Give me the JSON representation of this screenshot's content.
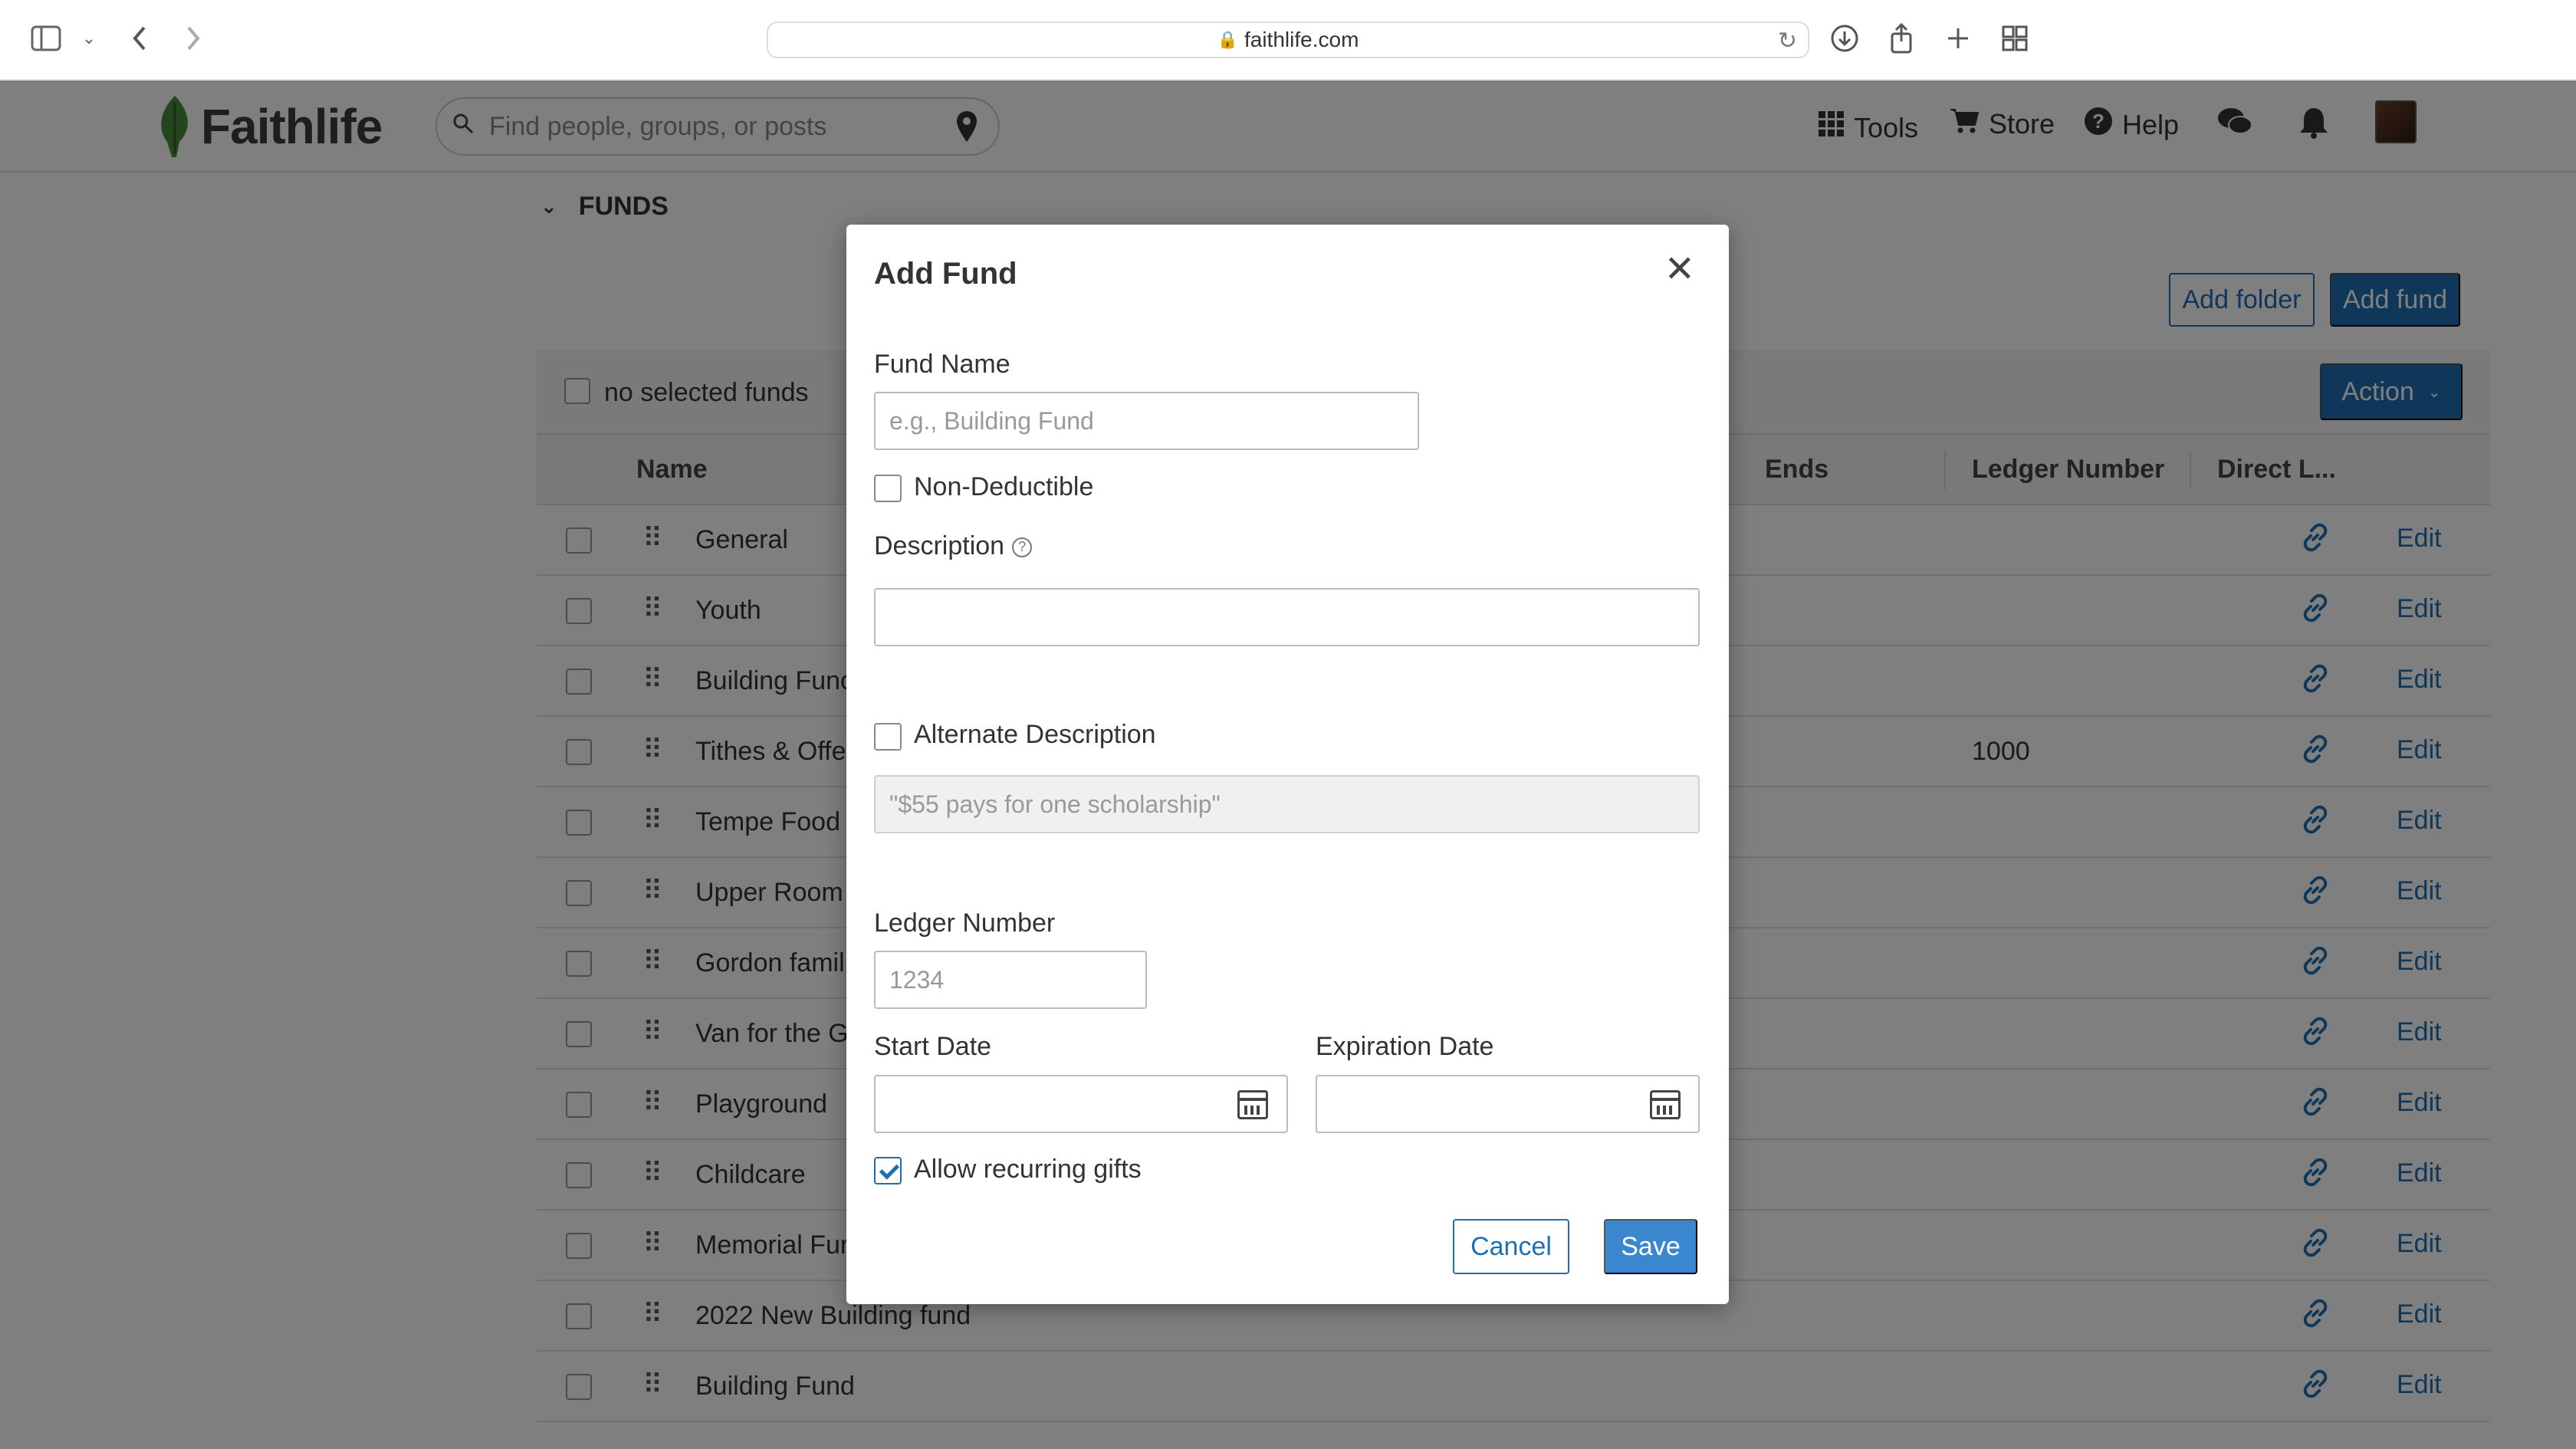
{
  "browser": {
    "url": "faithlife.com"
  },
  "header": {
    "logo_text": "Faithlife",
    "search_placeholder": "Find people, groups, or posts",
    "nav": [
      {
        "label": "Tools",
        "icon": "grid-icon"
      },
      {
        "label": "Store",
        "icon": "cart-icon"
      },
      {
        "label": "Help",
        "icon": "help-circle-icon"
      }
    ]
  },
  "page": {
    "section_title": "FUNDS",
    "add_folder_label": "Add folder",
    "add_fund_label": "Add fund",
    "selection_label": "no selected funds",
    "action_label": "Action",
    "columns": {
      "name": "Name",
      "ends": "Ends",
      "ledger": "Ledger Number",
      "direct_link": "Direct L..."
    },
    "rows": [
      {
        "name": "General",
        "ledger": "",
        "edit": "Edit"
      },
      {
        "name": "Youth",
        "ledger": "",
        "edit": "Edit"
      },
      {
        "name": "Building Func",
        "ledger": "",
        "edit": "Edit"
      },
      {
        "name": "Tithes & Offer",
        "ledger": "1000",
        "edit": "Edit"
      },
      {
        "name": "Tempe Food I",
        "ledger": "",
        "edit": "Edit"
      },
      {
        "name": "Upper Room",
        "ledger": "",
        "edit": "Edit"
      },
      {
        "name": "Gordon famil",
        "ledger": "",
        "edit": "Edit"
      },
      {
        "name": "Van for the Go",
        "ledger": "",
        "edit": "Edit"
      },
      {
        "name": "Playground",
        "ledger": "",
        "edit": "Edit"
      },
      {
        "name": "Childcare",
        "ledger": "",
        "edit": "Edit"
      },
      {
        "name": "Memorial Fur",
        "ledger": "",
        "edit": "Edit"
      },
      {
        "name": "2022 New Building fund",
        "ledger": "",
        "edit": "Edit"
      },
      {
        "name": "Building Fund",
        "ledger": "",
        "edit": "Edit"
      }
    ]
  },
  "modal": {
    "title": "Add Fund",
    "fund_name_label": "Fund Name",
    "fund_name_placeholder": "e.g., Building Fund",
    "fund_name_value": "",
    "non_deductible_label": "Non-Deductible",
    "non_deductible_checked": false,
    "description_label": "Description",
    "description_value": "",
    "alt_description_label": "Alternate Description",
    "alt_description_checked": false,
    "alt_description_placeholder": "\"$55 pays for one scholarship\"",
    "ledger_label": "Ledger Number",
    "ledger_placeholder": "1234",
    "start_date_label": "Start Date",
    "expiration_date_label": "Expiration Date",
    "recurring_label": "Allow recurring gifts",
    "recurring_checked": true,
    "cancel_label": "Cancel",
    "save_label": "Save"
  },
  "colors": {
    "brand_green": "#4a8b3c",
    "primary_blue": "#1f6fb5",
    "save_blue": "#3a87d0",
    "overlay": "rgba(0,0,0,0.5)"
  }
}
